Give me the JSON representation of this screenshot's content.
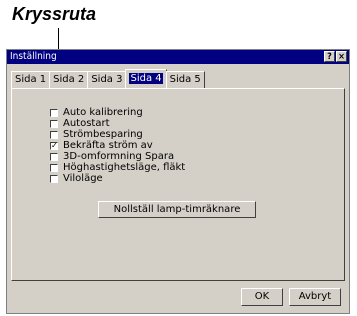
{
  "callout": {
    "label": "Kryssruta"
  },
  "window": {
    "title": "Inställning",
    "help_button": "?",
    "close_button": "×"
  },
  "tabs": [
    {
      "label": "Sida 1",
      "active": false
    },
    {
      "label": "Sida 2",
      "active": false
    },
    {
      "label": "Sida 3",
      "active": false
    },
    {
      "label": "Sida 4",
      "active": true
    },
    {
      "label": "Sida 5",
      "active": false
    }
  ],
  "options": [
    {
      "label": "Auto kalibrering",
      "checked": false
    },
    {
      "label": "Autostart",
      "checked": false
    },
    {
      "label": "Strömbesparing",
      "checked": false
    },
    {
      "label": "Bekräfta ström av",
      "checked": true
    },
    {
      "label": "3D-omformning Spara",
      "checked": false
    },
    {
      "label": "Höghastighetsläge, fläkt",
      "checked": false
    },
    {
      "label": "Viloläge",
      "checked": false
    }
  ],
  "reset_button": "Nollställ lamp-timräknare",
  "footer": {
    "ok": "OK",
    "cancel": "Avbryt"
  }
}
